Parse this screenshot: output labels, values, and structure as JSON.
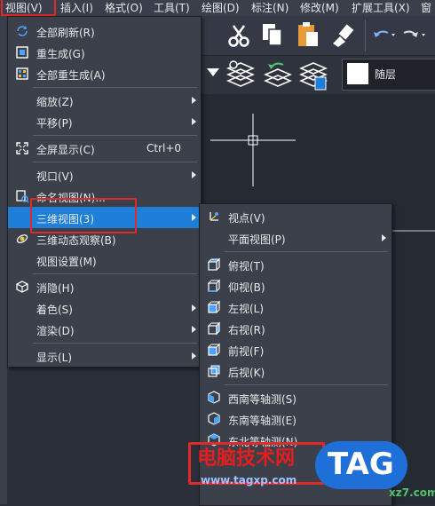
{
  "menubar": {
    "items": [
      "视图(V)",
      "插入(I)",
      "格式(O)",
      "工具(T)",
      "绘图(D)",
      "标注(N)",
      "修改(M)",
      "扩展工具(X)",
      "窗"
    ]
  },
  "layer": {
    "name": "随层"
  },
  "view_menu": {
    "items": [
      {
        "label": "全部刷新(R)",
        "icon": "refresh-icon"
      },
      {
        "label": "重生成(G)",
        "icon": "regen-icon"
      },
      {
        "label": "全部重生成(A)",
        "icon": "regen-all-icon"
      },
      {
        "label": "缩放(Z)",
        "submenu": true
      },
      {
        "label": "平移(P)",
        "submenu": true
      },
      {
        "label": "全屏显示(C)",
        "shortcut": "Ctrl+0",
        "icon": "fullscreen-icon"
      },
      {
        "label": "视口(V)",
        "submenu": true
      },
      {
        "label": "命名视图(N)...",
        "icon": "named-view-icon"
      },
      {
        "label": "三维视图(3)",
        "submenu": true,
        "selected": true
      },
      {
        "label": "三维动态观察(B)",
        "icon": "orbit-icon"
      },
      {
        "label": "视图设置(M)"
      },
      {
        "label": "消隐(H)",
        "icon": "hide-icon"
      },
      {
        "label": "着色(S)",
        "submenu": true
      },
      {
        "label": "渲染(D)",
        "submenu": true
      },
      {
        "label": "显示(L)",
        "submenu": true
      }
    ]
  },
  "view3d_menu": {
    "items": [
      {
        "label": "视点(V)",
        "icon": "viewpoint-icon"
      },
      {
        "label": "平面视图(P)",
        "submenu": true
      },
      {
        "label": "俯视(T)",
        "icon": "top-view-icon"
      },
      {
        "label": "仰视(B)",
        "icon": "bottom-view-icon"
      },
      {
        "label": "左视(L)",
        "icon": "left-view-icon"
      },
      {
        "label": "右视(R)",
        "icon": "right-view-icon"
      },
      {
        "label": "前视(F)",
        "icon": "front-view-icon"
      },
      {
        "label": "后视(K)",
        "icon": "back-view-icon"
      },
      {
        "label": "西南等轴测(S)",
        "icon": "sw-iso-icon"
      },
      {
        "label": "东南等轴测(E)",
        "icon": "se-iso-icon"
      },
      {
        "label": "东北等轴测(N)",
        "icon": "ne-iso-icon"
      }
    ]
  },
  "watermark": {
    "title": "电脑技术网",
    "url": "www.tagxp.com",
    "logo": "TAG",
    "site": "xz7.com"
  }
}
